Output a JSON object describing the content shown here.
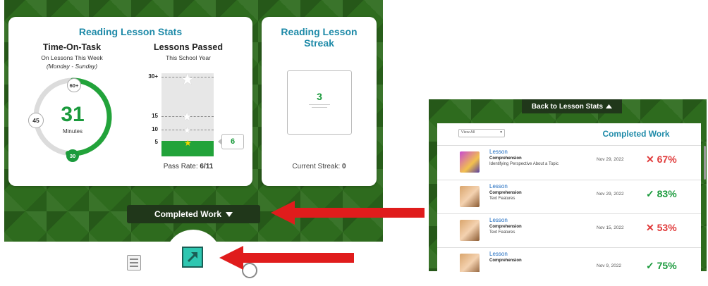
{
  "stats_card": {
    "title": "Reading Lesson Stats",
    "time_on_task": {
      "heading": "Time-On-Task",
      "subheading": "On Lessons This Week",
      "range": "(Monday - Sunday)",
      "value": "31",
      "unit": "Minutes",
      "goal_badge": "60+",
      "mid_badge": "45",
      "current_badge": "30",
      "progress_fraction": 0.52
    },
    "lessons_passed": {
      "heading": "Lessons Passed",
      "subheading": "This School Year",
      "ticks": [
        "30+",
        "15",
        "10",
        "5"
      ],
      "value": "6",
      "pass_rate_label": "Pass Rate:",
      "pass_rate_value": "6/11"
    }
  },
  "streak_card": {
    "title_line1": "Reading Lesson",
    "title_line2": "Streak",
    "streak_value": "3",
    "current_streak_label": "Current Streak:",
    "current_streak_value": "0"
  },
  "completed_work_button": "Completed Work",
  "back_button": "Back to Lesson Stats",
  "panel": {
    "view_select": "View All",
    "title": "Completed Work",
    "rows": [
      {
        "type": "Lesson",
        "subject": "Comprehension",
        "topic": "Identifying Perspective About a Topic",
        "date": "Nov 29, 2022",
        "score": "67%",
        "mark": "✕",
        "status": "fail"
      },
      {
        "type": "Lesson",
        "subject": "Comprehension",
        "topic": "Text Features",
        "date": "Nov 29, 2022",
        "score": "83%",
        "mark": "✓",
        "status": "pass"
      },
      {
        "type": "Lesson",
        "subject": "Comprehension",
        "topic": "Text Features",
        "date": "Nov 15, 2022",
        "score": "53%",
        "mark": "✕",
        "status": "fail"
      },
      {
        "type": "Lesson",
        "subject": "Comprehension",
        "topic": "",
        "date": "Nov 9, 2022",
        "score": "75%",
        "mark": "✓",
        "status": "pass"
      }
    ]
  },
  "colors": {
    "accent_teal": "#1e8aa8",
    "pass_green": "#1a9a3c",
    "fail_red": "#e03a3a",
    "annotation_arrow": "#e01c1c",
    "dark_button": "#20371a"
  },
  "icons": [
    "star-icon",
    "caret-down-icon",
    "caret-up-icon",
    "lesson-arrow-icon",
    "checklist-icon",
    "chevron-down-icon"
  ]
}
